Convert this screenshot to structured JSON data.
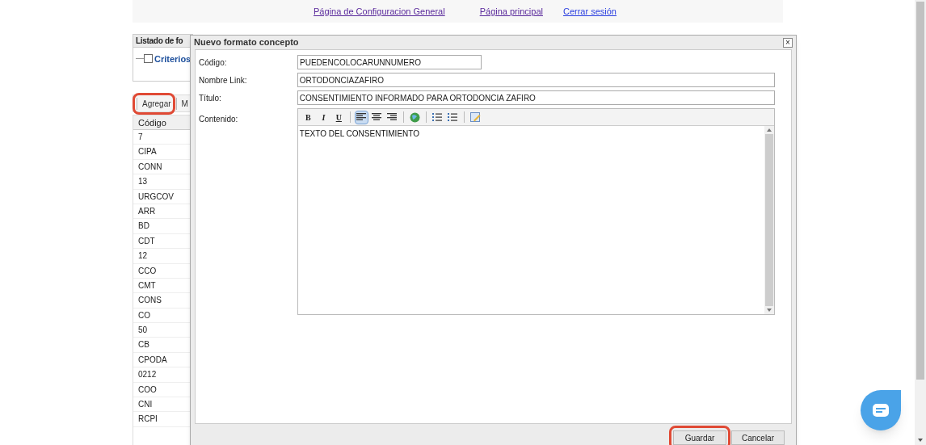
{
  "top_links": [
    "Página de Configuracion General",
    "Página principal",
    "Cerrar sesión"
  ],
  "list_panel": {
    "title": "Listado de fo",
    "criteria": {
      "label": "Criterios",
      "checked": false
    },
    "toolbar": [
      {
        "label": "Agregar",
        "highlighted": true
      },
      {
        "label": "M",
        "highlighted": false
      }
    ],
    "table": {
      "columns": [
        "Código"
      ],
      "rows": [
        "7",
        "CIPA",
        "CONN",
        "13",
        "URGCOV",
        "ARR",
        "BD",
        "CDT",
        "12",
        "CCO",
        "CMT",
        "CONS",
        "CO",
        "50",
        "CB",
        "CPODA",
        "0212",
        "COO",
        "CNI",
        "RCPI"
      ]
    }
  },
  "dialog": {
    "title": "Nuevo formato concepto",
    "close": "×",
    "fields": [
      {
        "label": "Código:",
        "value": "PUEDENCOLOCARUNNUMERO",
        "kind": "short"
      },
      {
        "label": "Nombre Link:",
        "value": "ORTODONCIAZAFIRO",
        "kind": "long"
      },
      {
        "label": "Título:",
        "value": "CONSENTIMIENTO INFORMADO PARA ORTODONCIA ZAFIRO",
        "kind": "long"
      }
    ],
    "content": {
      "label": "Contenido:",
      "text": "TEXTO DEL CONSENTIMIENTO",
      "tools": [
        {
          "kind": "bold",
          "label": "B",
          "selected": false
        },
        {
          "kind": "italic",
          "label": "I",
          "selected": false
        },
        {
          "kind": "underline",
          "label": "U",
          "selected": false
        },
        {
          "kind": "separator"
        },
        {
          "kind": "align-left",
          "selected": true
        },
        {
          "kind": "align-center",
          "selected": false
        },
        {
          "kind": "align-right",
          "selected": false
        },
        {
          "kind": "separator"
        },
        {
          "kind": "globe",
          "selected": false
        },
        {
          "kind": "separator"
        },
        {
          "kind": "numbered-list",
          "selected": false
        },
        {
          "kind": "bullet-list",
          "selected": false
        },
        {
          "kind": "separator"
        },
        {
          "kind": "edit-html",
          "selected": false
        }
      ]
    },
    "buttons": [
      {
        "label": "Guardar",
        "highlighted": true
      },
      {
        "label": "Cancelar",
        "highlighted": false
      }
    ]
  }
}
